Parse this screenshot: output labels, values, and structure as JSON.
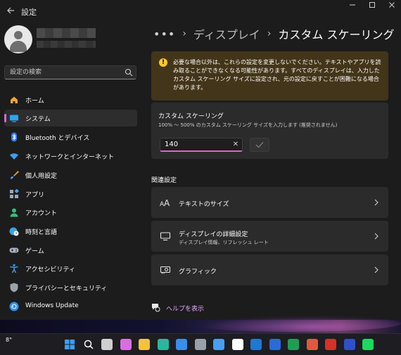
{
  "app": {
    "title": "設定"
  },
  "search": {
    "placeholder": "設定の検索"
  },
  "sidebar": {
    "items": [
      {
        "label": "ホーム",
        "icon": "home-icon",
        "color": "#f0a830"
      },
      {
        "label": "システム",
        "icon": "system-icon",
        "color": "#2aa4f4",
        "active": true
      },
      {
        "label": "Bluetooth とデバイス",
        "icon": "bluetooth-icon",
        "color": "#2f7cf0"
      },
      {
        "label": "ネットワークとインターネット",
        "icon": "wifi-icon",
        "color": "#3ba0e8"
      },
      {
        "label": "個人用設定",
        "icon": "brush-icon",
        "color": "#e8a040"
      },
      {
        "label": "アプリ",
        "icon": "apps-icon",
        "color": "#9aa6b8"
      },
      {
        "label": "アカウント",
        "icon": "account-icon",
        "color": "#2fc07a"
      },
      {
        "label": "時刻と言語",
        "icon": "globe-clock-icon",
        "color": "#3aa3e6"
      },
      {
        "label": "ゲーム",
        "icon": "gamepad-icon",
        "color": "#a9b3c0"
      },
      {
        "label": "アクセシビリティ",
        "icon": "accessibility-icon",
        "color": "#3a9be6"
      },
      {
        "label": "プライバシーとセキュリティ",
        "icon": "shield-icon",
        "color": "#9aa3ad"
      },
      {
        "label": "Windows Update",
        "icon": "windows-update-icon",
        "color": "#2f90e8"
      }
    ]
  },
  "breadcrumb": {
    "more": "•••",
    "items": [
      "ディスプレイ",
      "カスタム スケーリング"
    ]
  },
  "warning": {
    "text": "必要な場合以外は、これらの設定を変更しないでください。テキストやアプリを読み取ることができなくなる可能性があります。すべてのディスプレイは、入力したカスタム スケーリング サイズに設定され、元の設定に戻すことが困難になる場合があります。"
  },
  "scaling": {
    "title": "カスタム スケーリング",
    "description": "100% 〜 500% のカスタム スケーリング サイズを入力します (推奨されません)",
    "value": "140"
  },
  "related": {
    "heading": "関連設定",
    "links": [
      {
        "label": "テキストのサイズ",
        "sub": "",
        "icon": "text-size-icon"
      },
      {
        "label": "ディスプレイの詳細設定",
        "sub": "ディスプレイ情報、リフレッシュ レート",
        "icon": "monitor-icon"
      },
      {
        "label": "グラフィック",
        "sub": "",
        "icon": "graphics-card-icon"
      }
    ]
  },
  "help": {
    "label": "ヘルプを表示"
  },
  "taskbar": {
    "weather": "8°",
    "icons": [
      {
        "name": "start-icon",
        "color": "#3aa0f0"
      },
      {
        "name": "search-icon",
        "color": "#ffffff"
      },
      {
        "name": "task-view-icon",
        "color": "#cfcfcf"
      },
      {
        "name": "copilot-icon",
        "color": "#d86fe0"
      },
      {
        "name": "file-explorer-icon",
        "color": "#f3c33c"
      },
      {
        "name": "edge-icon",
        "color": "#2bb6a0"
      },
      {
        "name": "store-icon",
        "color": "#3a8ee6"
      },
      {
        "name": "media-icon",
        "color": "#9aa0a8"
      },
      {
        "name": "app-icon",
        "color": "#4a9ef0"
      },
      {
        "name": "clock-app-icon",
        "color": "#ffffff"
      },
      {
        "name": "outlook-icon",
        "color": "#1f78d1"
      },
      {
        "name": "word-icon",
        "color": "#2b6bd6"
      },
      {
        "name": "excel-icon",
        "color": "#1f9d55"
      },
      {
        "name": "powerpoint-icon",
        "color": "#e2583e"
      },
      {
        "name": "mail-icon",
        "color": "#d93025"
      },
      {
        "name": "photo-app-icon",
        "color": "#3050c8"
      },
      {
        "name": "spotify-icon",
        "color": "#1ed760"
      }
    ]
  }
}
